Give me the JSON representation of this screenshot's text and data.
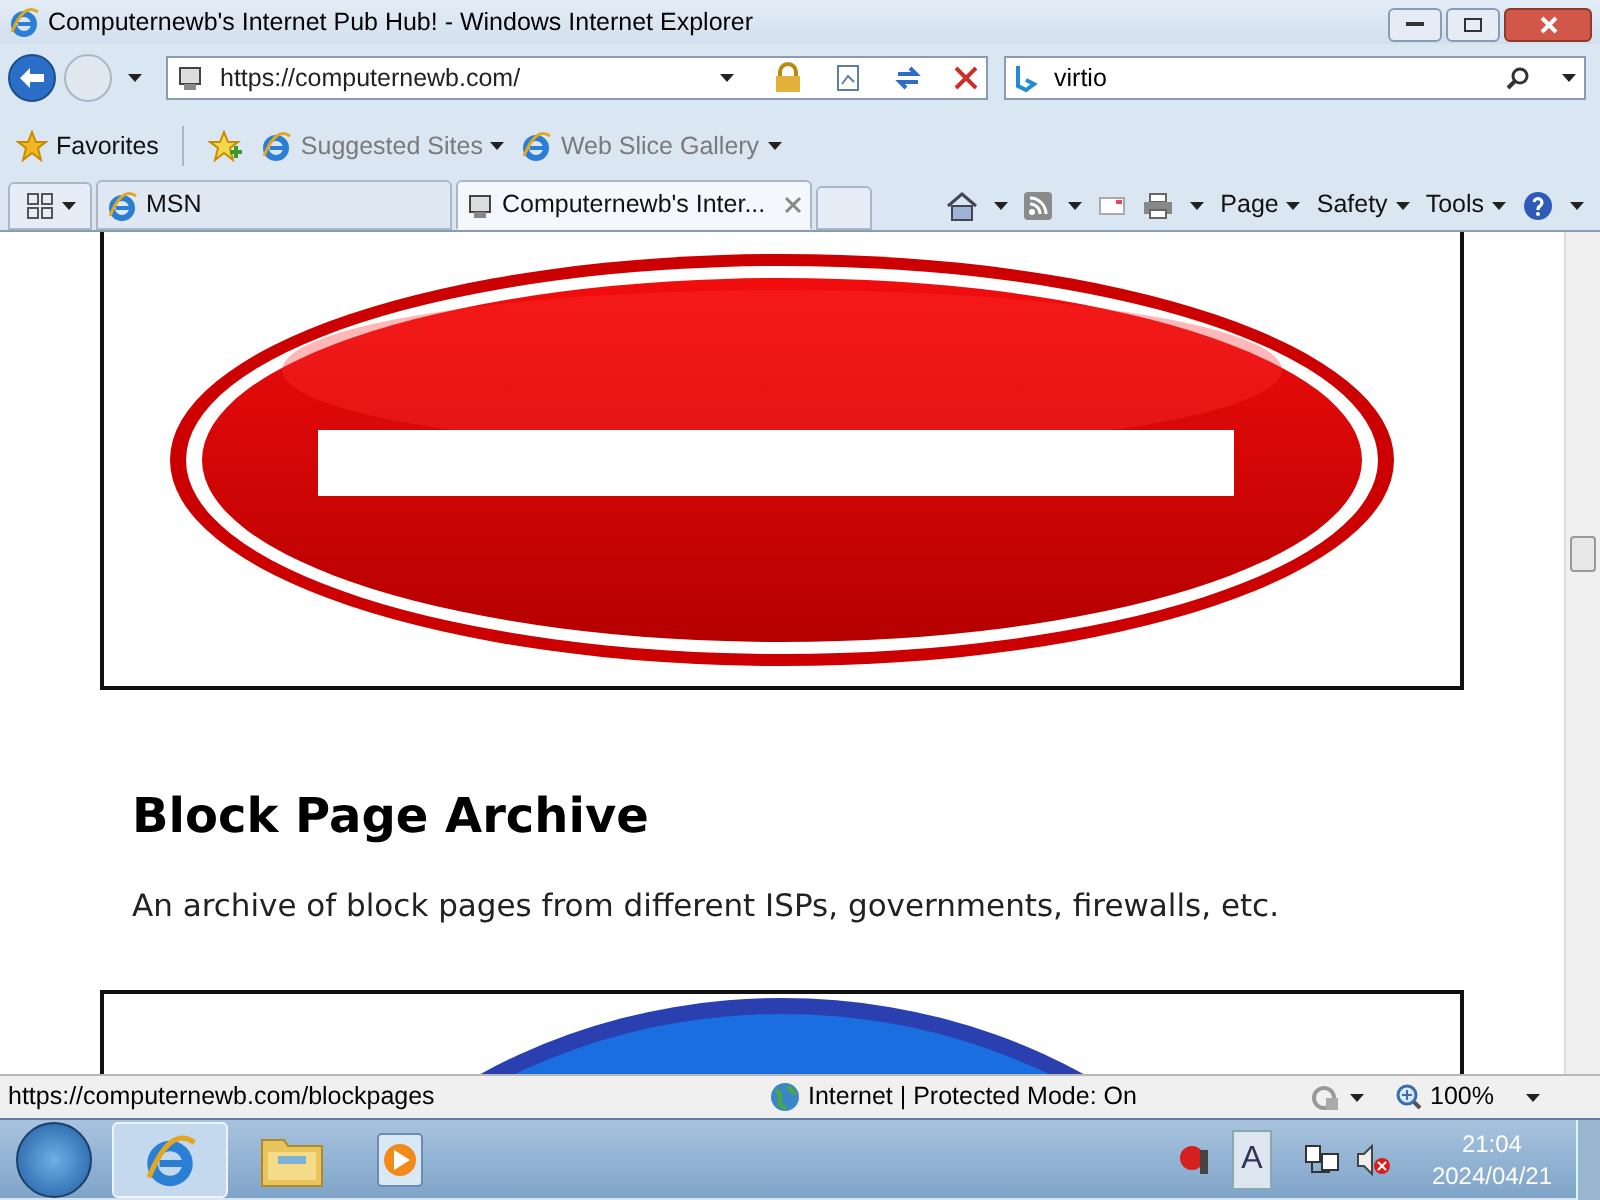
{
  "window": {
    "title": "Computernewb's Internet Pub Hub! - Windows Internet Explorer"
  },
  "navigation": {
    "address": "https://computernewb.com/",
    "search": "virtio"
  },
  "favorites_bar": {
    "items": [
      {
        "label": "Favorites"
      },
      {
        "label": "Suggested Sites"
      },
      {
        "label": "Web Slice Gallery"
      }
    ]
  },
  "tabs": [
    {
      "label": "MSN",
      "selected": false
    },
    {
      "label": "Computernewb's Inter...",
      "selected": true
    }
  ],
  "command_bar": [
    "Page",
    "Safety",
    "Tools"
  ],
  "page": {
    "heading": "Block Page Archive",
    "description": "An archive of block pages from different ISPs, governments, firewalls, etc."
  },
  "status_bar": {
    "url": "https://computernewb.com/blockpages",
    "zone": "Internet | Protected Mode: On",
    "zoom": "100%"
  },
  "taskbar": {
    "ime": "A",
    "time": "21:04",
    "date": "2024/04/21"
  }
}
